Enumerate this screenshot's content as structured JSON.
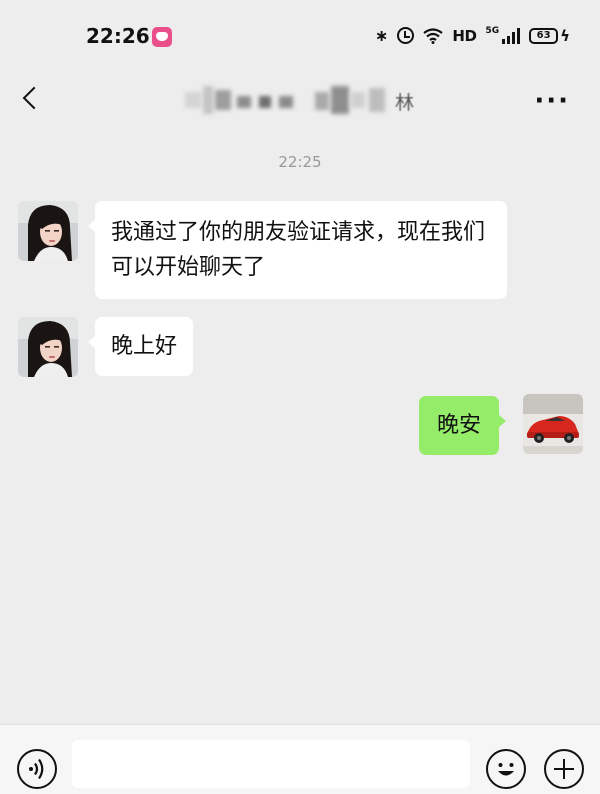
{
  "status_bar": {
    "time": "22:26",
    "hd": "HD",
    "network": "5G",
    "battery": "63"
  },
  "header": {
    "title_visible": "林"
  },
  "chat": {
    "timestamp": "22:25",
    "messages": [
      {
        "sender": "contact",
        "text": "我通过了你的朋友验证请求，现在我们可以开始聊天了"
      },
      {
        "sender": "contact",
        "text": "晚上好"
      },
      {
        "sender": "me",
        "text": "晚安"
      }
    ]
  },
  "icons": {
    "back": "back-arrow-icon",
    "more": "more-icon",
    "voice": "voice-icon",
    "emoji": "emoji-icon",
    "plus": "plus-icon"
  },
  "colors": {
    "background": "#ededed",
    "my_bubble": "#95ec69",
    "contact_bubble": "#ffffff",
    "timestamp": "#999999"
  }
}
